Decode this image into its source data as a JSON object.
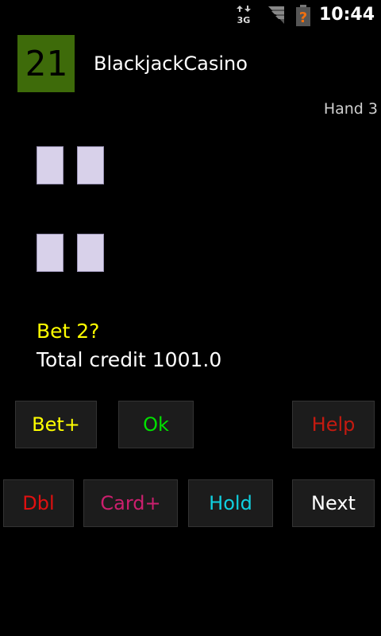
{
  "status_bar": {
    "time": "10:44",
    "network_label": "3G",
    "icons": [
      "3g-data-icon",
      "signal-icon",
      "battery-alert-icon"
    ]
  },
  "app": {
    "icon_text": "21",
    "title": "BlackjackCasino"
  },
  "game": {
    "hand_label": "Hand 3",
    "bet_prompt": "Bet 2?",
    "credit_text": "Total credit 1001.0"
  },
  "buttons": {
    "bet_plus": "Bet+",
    "ok": "Ok",
    "help": "Help",
    "dbl": "Dbl",
    "card_plus": "Card+",
    "hold": "Hold",
    "next": "Next"
  },
  "colors": {
    "background": "#000000",
    "app_icon_bg": "#3e6b0a",
    "card_back": "#d8d1ea",
    "bet_text": "#ffff00",
    "ok_text": "#00e000",
    "help_text": "#c41a10",
    "dbl_text": "#e01010",
    "card_plus_text": "#cc1f6e",
    "hold_text": "#10d0e0"
  }
}
